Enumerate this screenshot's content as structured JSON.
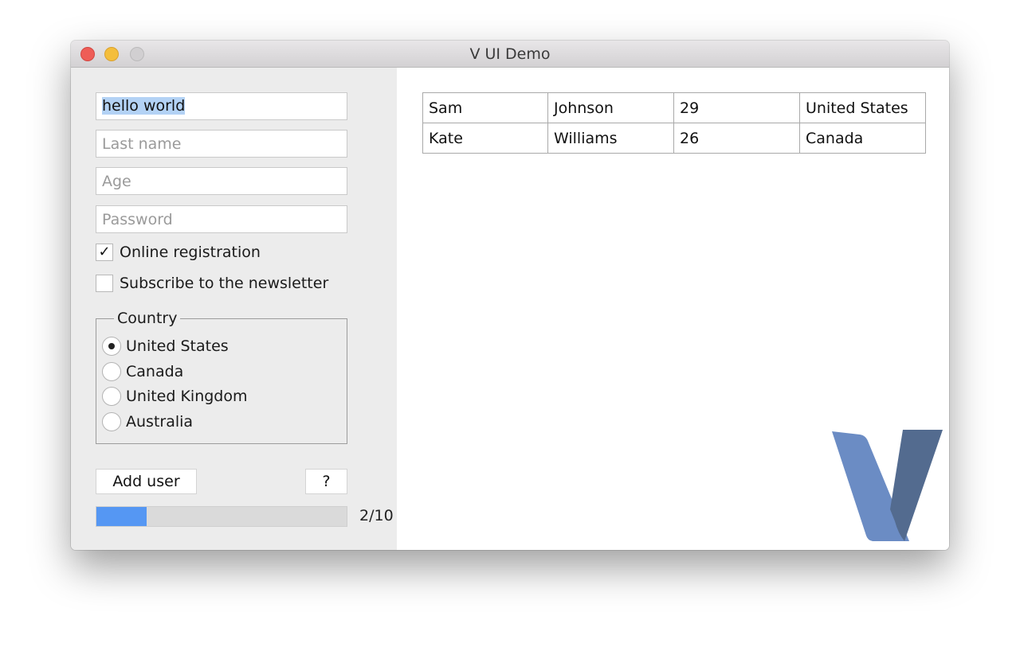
{
  "window": {
    "title": "V UI Demo"
  },
  "form": {
    "first_name_value": "hello world",
    "last_name_placeholder": "Last name",
    "age_placeholder": "Age",
    "password_placeholder": "Password",
    "online_registration": {
      "label": "Online registration",
      "checked": true
    },
    "newsletter": {
      "label": "Subscribe to the newsletter",
      "checked": false
    },
    "country_group": {
      "title": "Country",
      "options": [
        {
          "label": "United States",
          "selected": true
        },
        {
          "label": "Canada",
          "selected": false
        },
        {
          "label": "United Kingdom",
          "selected": false
        },
        {
          "label": "Australia",
          "selected": false
        }
      ]
    },
    "add_user_label": "Add user",
    "help_label": "?",
    "progress": {
      "current": 2,
      "max": 10,
      "text": "2/10"
    }
  },
  "users_table": {
    "rows": [
      [
        "Sam",
        "Johnson",
        "29",
        "United States"
      ],
      [
        "Kate",
        "Williams",
        "26",
        "Canada"
      ]
    ]
  },
  "colors": {
    "progress_fill": "#5597f3",
    "logo_light": "#6b8cc4",
    "logo_dark": "#536b8f",
    "close_light": "#ee5d57",
    "minimize_light": "#f4be3c"
  },
  "icons": {
    "logo": "v-logo-icon",
    "checkmark": "checkmark-icon"
  }
}
